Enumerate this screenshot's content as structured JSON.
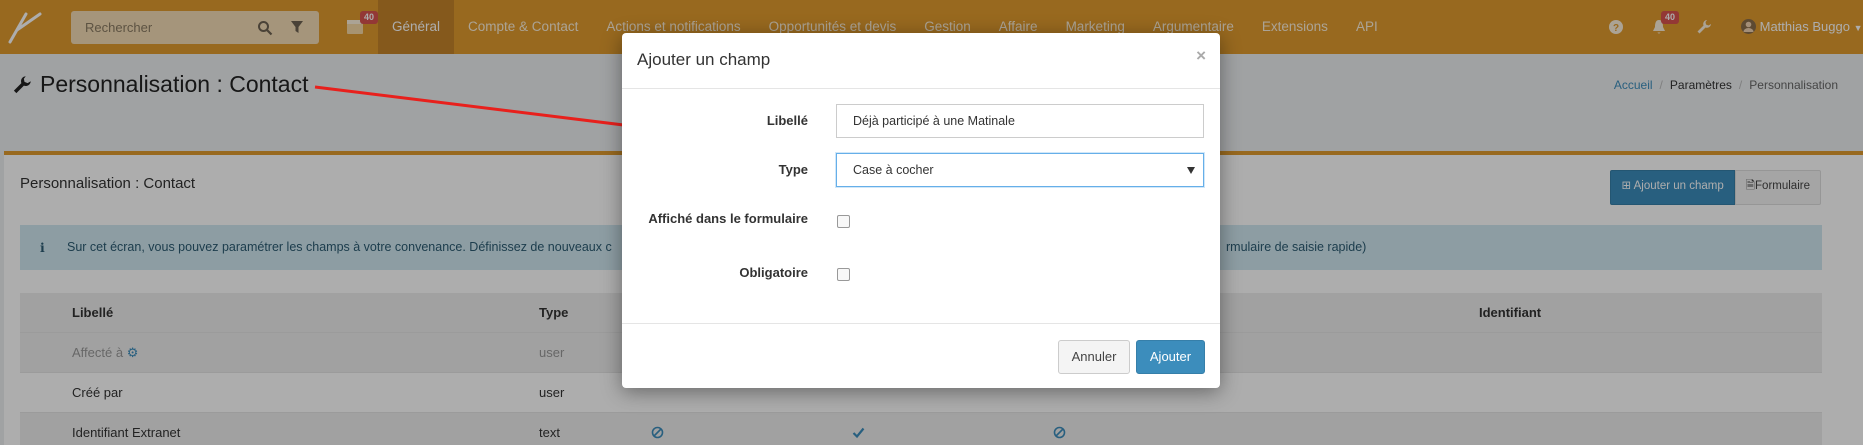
{
  "colors": {
    "accent": "#e09b2f",
    "primary": "#3c8dbc",
    "danger": "#d9534f",
    "info_bg": "#d0e8f0",
    "arrow": "#e8201c"
  },
  "navbar": {
    "search_placeholder": "Rechercher",
    "calendar_badge": "40",
    "menu": [
      "Général",
      "Compte & Contact",
      "Actions et notifications",
      "Opportunités et devis",
      "Gestion",
      "Affaire",
      "Marketing",
      "Argumentaire",
      "Extensions",
      "API"
    ],
    "active_menu": "Général",
    "notifications_badge": "40",
    "user_name": "Matthias Buggo"
  },
  "page": {
    "title": "Personnalisation : Contact",
    "breadcrumb": [
      "Accueil",
      "Paramètres",
      "Personnalisation"
    ]
  },
  "panel": {
    "title": "Personnalisation : Contact",
    "add_button": "Ajouter un champ",
    "form_button": "Formulaire",
    "info_text": "Sur cet écran, vous pouvez paramétrer les champs à votre convenance. Définissez de nouveaux c",
    "info_text_end": "rmulaire de saisie rapide)"
  },
  "table": {
    "headers": {
      "label": "Libellé",
      "type": "Type",
      "identifier": "Identifiant"
    },
    "rows": [
      {
        "label": "Affecté à",
        "type": "user"
      },
      {
        "label": "Créé par",
        "type": "user"
      },
      {
        "label": "Identifiant Extranet",
        "type": "text"
      }
    ]
  },
  "modal": {
    "title": "Ajouter un champ",
    "close": "×",
    "libelle_label": "Libellé",
    "libelle_value": "Déjà participé à une Matinale",
    "type_label": "Type",
    "type_value": "Case à cocher",
    "form_display_label": "Affiché dans le formulaire",
    "required_label": "Obligatoire",
    "cancel_button": "Annuler",
    "submit_button": "Ajouter"
  },
  "icons": [
    "logo-icon",
    "search-icon",
    "filter-icon",
    "calendar-icon",
    "help-icon",
    "bell-icon",
    "wrench-icon",
    "avatar-icon",
    "gear-icon",
    "ban-icon",
    "check-icon",
    "info-icon",
    "plus-icon",
    "file-icon",
    "caret-down-icon"
  ]
}
